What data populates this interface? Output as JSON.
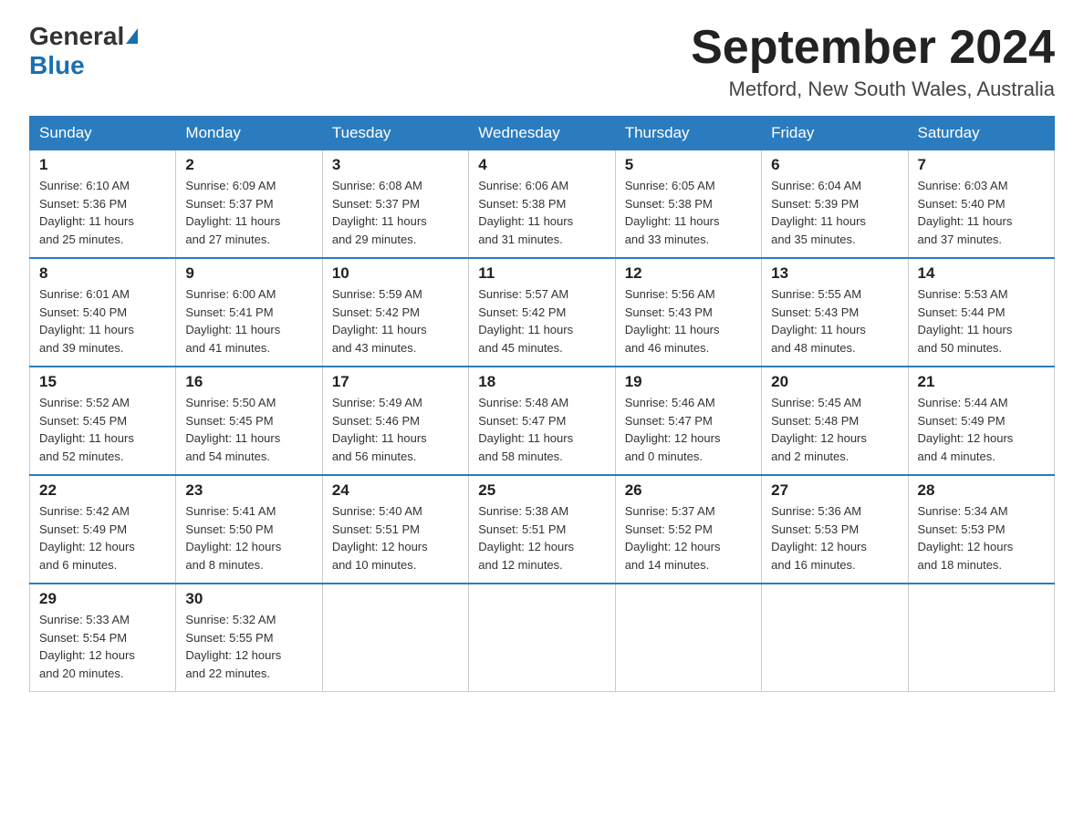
{
  "logo": {
    "general": "General",
    "blue": "Blue"
  },
  "title": {
    "month_year": "September 2024",
    "location": "Metford, New South Wales, Australia"
  },
  "headers": [
    "Sunday",
    "Monday",
    "Tuesday",
    "Wednesday",
    "Thursday",
    "Friday",
    "Saturday"
  ],
  "weeks": [
    [
      {
        "day": "1",
        "sunrise": "6:10 AM",
        "sunset": "5:36 PM",
        "daylight": "11 hours and 25 minutes."
      },
      {
        "day": "2",
        "sunrise": "6:09 AM",
        "sunset": "5:37 PM",
        "daylight": "11 hours and 27 minutes."
      },
      {
        "day": "3",
        "sunrise": "6:08 AM",
        "sunset": "5:37 PM",
        "daylight": "11 hours and 29 minutes."
      },
      {
        "day": "4",
        "sunrise": "6:06 AM",
        "sunset": "5:38 PM",
        "daylight": "11 hours and 31 minutes."
      },
      {
        "day": "5",
        "sunrise": "6:05 AM",
        "sunset": "5:38 PM",
        "daylight": "11 hours and 33 minutes."
      },
      {
        "day": "6",
        "sunrise": "6:04 AM",
        "sunset": "5:39 PM",
        "daylight": "11 hours and 35 minutes."
      },
      {
        "day": "7",
        "sunrise": "6:03 AM",
        "sunset": "5:40 PM",
        "daylight": "11 hours and 37 minutes."
      }
    ],
    [
      {
        "day": "8",
        "sunrise": "6:01 AM",
        "sunset": "5:40 PM",
        "daylight": "11 hours and 39 minutes."
      },
      {
        "day": "9",
        "sunrise": "6:00 AM",
        "sunset": "5:41 PM",
        "daylight": "11 hours and 41 minutes."
      },
      {
        "day": "10",
        "sunrise": "5:59 AM",
        "sunset": "5:42 PM",
        "daylight": "11 hours and 43 minutes."
      },
      {
        "day": "11",
        "sunrise": "5:57 AM",
        "sunset": "5:42 PM",
        "daylight": "11 hours and 45 minutes."
      },
      {
        "day": "12",
        "sunrise": "5:56 AM",
        "sunset": "5:43 PM",
        "daylight": "11 hours and 46 minutes."
      },
      {
        "day": "13",
        "sunrise": "5:55 AM",
        "sunset": "5:43 PM",
        "daylight": "11 hours and 48 minutes."
      },
      {
        "day": "14",
        "sunrise": "5:53 AM",
        "sunset": "5:44 PM",
        "daylight": "11 hours and 50 minutes."
      }
    ],
    [
      {
        "day": "15",
        "sunrise": "5:52 AM",
        "sunset": "5:45 PM",
        "daylight": "11 hours and 52 minutes."
      },
      {
        "day": "16",
        "sunrise": "5:50 AM",
        "sunset": "5:45 PM",
        "daylight": "11 hours and 54 minutes."
      },
      {
        "day": "17",
        "sunrise": "5:49 AM",
        "sunset": "5:46 PM",
        "daylight": "11 hours and 56 minutes."
      },
      {
        "day": "18",
        "sunrise": "5:48 AM",
        "sunset": "5:47 PM",
        "daylight": "11 hours and 58 minutes."
      },
      {
        "day": "19",
        "sunrise": "5:46 AM",
        "sunset": "5:47 PM",
        "daylight": "12 hours and 0 minutes."
      },
      {
        "day": "20",
        "sunrise": "5:45 AM",
        "sunset": "5:48 PM",
        "daylight": "12 hours and 2 minutes."
      },
      {
        "day": "21",
        "sunrise": "5:44 AM",
        "sunset": "5:49 PM",
        "daylight": "12 hours and 4 minutes."
      }
    ],
    [
      {
        "day": "22",
        "sunrise": "5:42 AM",
        "sunset": "5:49 PM",
        "daylight": "12 hours and 6 minutes."
      },
      {
        "day": "23",
        "sunrise": "5:41 AM",
        "sunset": "5:50 PM",
        "daylight": "12 hours and 8 minutes."
      },
      {
        "day": "24",
        "sunrise": "5:40 AM",
        "sunset": "5:51 PM",
        "daylight": "12 hours and 10 minutes."
      },
      {
        "day": "25",
        "sunrise": "5:38 AM",
        "sunset": "5:51 PM",
        "daylight": "12 hours and 12 minutes."
      },
      {
        "day": "26",
        "sunrise": "5:37 AM",
        "sunset": "5:52 PM",
        "daylight": "12 hours and 14 minutes."
      },
      {
        "day": "27",
        "sunrise": "5:36 AM",
        "sunset": "5:53 PM",
        "daylight": "12 hours and 16 minutes."
      },
      {
        "day": "28",
        "sunrise": "5:34 AM",
        "sunset": "5:53 PM",
        "daylight": "12 hours and 18 minutes."
      }
    ],
    [
      {
        "day": "29",
        "sunrise": "5:33 AM",
        "sunset": "5:54 PM",
        "daylight": "12 hours and 20 minutes."
      },
      {
        "day": "30",
        "sunrise": "5:32 AM",
        "sunset": "5:55 PM",
        "daylight": "12 hours and 22 minutes."
      },
      null,
      null,
      null,
      null,
      null
    ]
  ],
  "labels": {
    "sunrise": "Sunrise:",
    "sunset": "Sunset:",
    "daylight": "Daylight:"
  }
}
